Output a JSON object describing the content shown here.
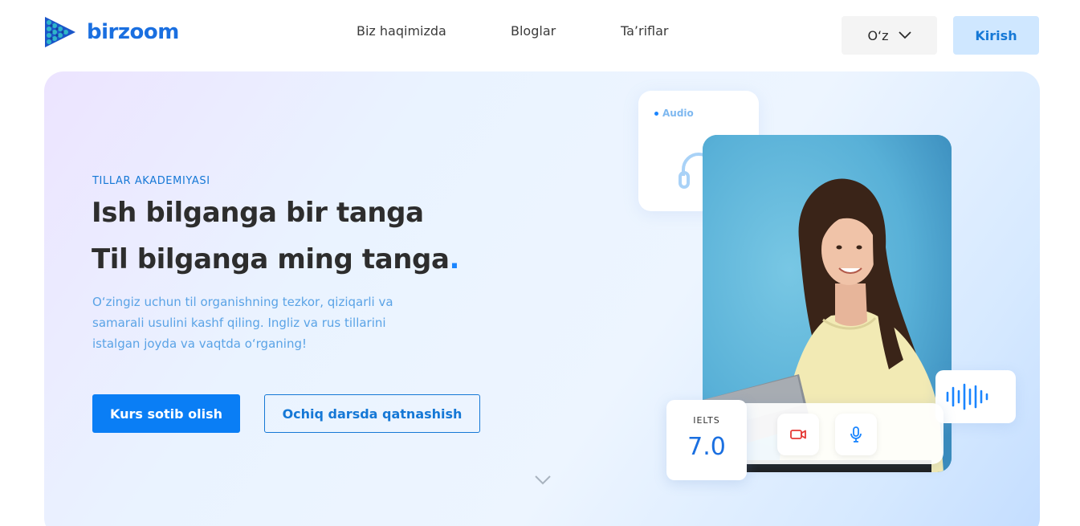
{
  "brand": {
    "name": "birzoom",
    "color": "#1a6fe0"
  },
  "nav": {
    "items": [
      {
        "label": "Biz haqimizda"
      },
      {
        "label": "Bloglar"
      },
      {
        "label": "Ta’riflar"
      }
    ]
  },
  "header": {
    "language": "O‘z",
    "login_label": "Kirish"
  },
  "hero": {
    "eyebrow": "TILLAR AKADEMIYASI",
    "title_line1": "Ish bilganga bir tanga",
    "title_line2": "Til bilganga ming tanga",
    "title_dot": ".",
    "description": "O‘zingiz uchun til organishning tezkor, qiziqarli va samarali usulini kashf qiling. Ingliz va rus tillarini istalgan joyda va vaqtda o‘rganing!",
    "primary_button": "Kurs sotib olish",
    "secondary_button": "Ochiq darsda qatnashish"
  },
  "visual": {
    "audio_label": "Audio",
    "ielts_label": "IELTS",
    "ielts_score": "7.0"
  },
  "colors": {
    "accent": "#0a7ef5",
    "login_bg": "#cfe7ff",
    "video_icon": "#e53935",
    "mic_icon": "#1a85ff"
  }
}
